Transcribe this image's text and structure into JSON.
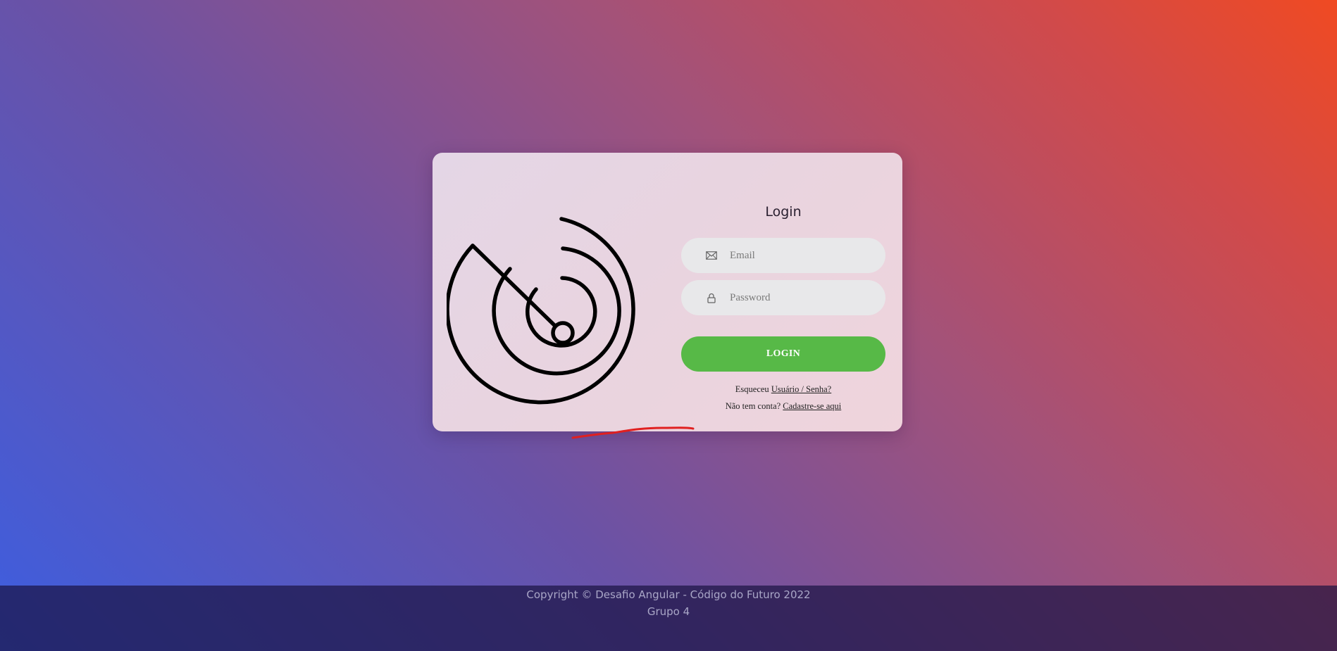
{
  "login": {
    "title": "Login",
    "email_placeholder": "Email",
    "password_placeholder": "Password",
    "button_label": "LOGIN",
    "forgot_prefix": "Esqueceu",
    "forgot_link": "Usuário / Senha?",
    "signup_prefix": "Não tem conta?",
    "signup_link": "Cadastre-se aqui",
    "email_icon": "envelope-icon",
    "password_icon": "lock-icon",
    "button_color": "#57b947"
  },
  "logo": {
    "icon": "radar-logo-icon"
  },
  "footer": {
    "copyright": "Copyright © Desafio Angular - Código do Futuro 2022",
    "group": "Grupo 4"
  },
  "colors": {
    "gradient_start": "#3d5ee0",
    "gradient_end": "#f04a22",
    "scribble": "#e02020"
  }
}
